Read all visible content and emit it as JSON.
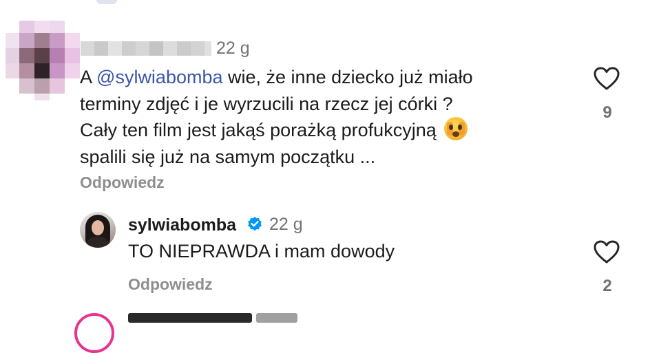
{
  "comment": {
    "time": "22 g",
    "text_before_mention": "A ",
    "mention": "@sylwiabomba",
    "text_line1_rest": " wie, że inne dziecko już miało",
    "line2": "terminy zdjęć i je wyrzucili na rzecz jej córki ?",
    "line3": "Cały ten film jest jakąś porażką profukcyjną",
    "line4": "spalili się już na samym początku ...",
    "reply_label": "Odpowiedz",
    "likes": "9",
    "emoji_icon": "face-with-hand-over-mouth"
  },
  "reply": {
    "username": "sylwiabomba",
    "time": "22 g",
    "text": "TO NIEPRAWDA i mam dowody",
    "reply_label": "Odpowiedz",
    "likes": "2",
    "verified_icon": "verified-badge-icon"
  },
  "colors": {
    "mention": "#3b56a8",
    "verified": "#0095f6",
    "muted": "#8e8e8e"
  }
}
